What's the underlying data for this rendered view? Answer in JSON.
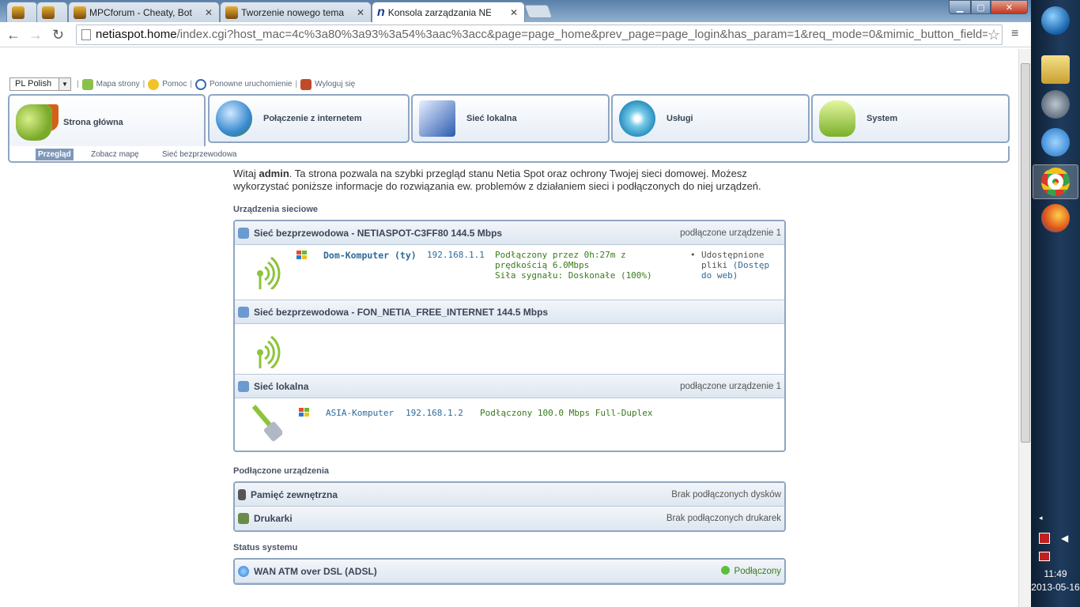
{
  "browser": {
    "tabs": [
      {
        "label": ""
      },
      {
        "label": ""
      },
      {
        "label": "MPCforum - Cheaty, Boty"
      },
      {
        "label": "Tworzenie nowego temat"
      },
      {
        "label": "Konsola zarządzania NETIA"
      }
    ],
    "url_host": "netiaspot.home",
    "url_rest": "/index.cgi?host_mac=4c%3a80%3a93%3a54%3aac%3acc&page=page_home&prev_page=page_login&has_param=1&req_mode=0&mimic_button_field="
  },
  "topbar": {
    "language": "PL Polish",
    "links": [
      "Mapa strony",
      "Pomoc",
      "Ponowne uruchomienie",
      "Wyloguj się"
    ]
  },
  "nav": {
    "tabs": [
      "Strona główna",
      "Połączenie z internetem",
      "Sieć lokalna",
      "Usługi",
      "System"
    ],
    "subtabs": [
      "Przegląd",
      "Zobacz mapę",
      "Sieć bezprzewodowa"
    ]
  },
  "welcome": {
    "pre": "Witaj ",
    "user": "admin",
    "post": ". Ta strona pozwala na szybki przegląd stanu Netia Spot oraz ochrony Twojej sieci domowej. Możesz wykorzystać poniższe informacje do rozwiązania ew. problemów z działaniem sieci i podłączonych do niej urządzeń."
  },
  "devices": {
    "title": "Urządzenia sieciowe",
    "wireless1": {
      "title": "Sieć bezprzewodowa - NETIASPOT-C3FF80 144.5 Mbps",
      "count": "podłączone urządzenie 1",
      "name": "Dom-Komputer (ty)",
      "ip": "192.168.1.1",
      "status1": "Podłączony przez 0h:27m z",
      "status2": "prędkością 6.0Mbps",
      "status3": "Siła sygnału: Doskonałe (100%)",
      "share1": "Udostępnione",
      "share2": "pliki",
      "share_link1": "(Dostęp",
      "share_link2": "do web)"
    },
    "wireless2": {
      "title": "Sieć bezprzewodowa - FON_NETIA_FREE_INTERNET 144.5 Mbps"
    },
    "lan": {
      "title": "Sieć lokalna",
      "count": "podłączone urządzenie 1",
      "name": "ASIA-Komputer",
      "ip": "192.168.1.2",
      "status": "Podłączony 100.0 Mbps Full-Duplex"
    }
  },
  "connected": {
    "title": "Podłączone urządzenia",
    "storage": {
      "label": "Pamięć zewnętrzna",
      "status": "Brak podłączonych dysków"
    },
    "printers": {
      "label": "Drukarki",
      "status": "Brak podłączonych drukarek"
    }
  },
  "system": {
    "title": "Status systemu",
    "wan": {
      "label": "WAN ATM over DSL (ADSL)",
      "status": "Podłączony"
    }
  },
  "clock": {
    "time": "11:49",
    "date": "2013-05-16"
  }
}
